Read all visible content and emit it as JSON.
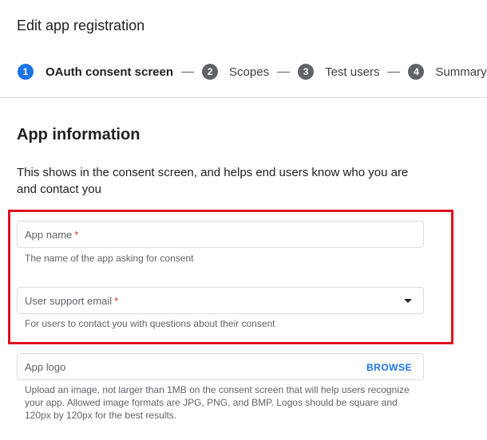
{
  "page": {
    "title": "Edit app registration"
  },
  "stepper": {
    "steps": [
      {
        "number": "1",
        "label": "OAuth consent screen"
      },
      {
        "number": "2",
        "label": "Scopes"
      },
      {
        "number": "3",
        "label": "Test users"
      },
      {
        "number": "4",
        "label": "Summary"
      }
    ]
  },
  "section": {
    "title": "App information",
    "description": "This shows in the consent screen, and helps end users know who you are and contact you"
  },
  "fields": {
    "app_name": {
      "label": "App name",
      "required_mark": "*",
      "helper": "The name of the app asking for consent"
    },
    "support_email": {
      "label": "User support email",
      "required_mark": "*",
      "helper": "For users to contact you with questions about their consent"
    },
    "app_logo": {
      "label": "App logo",
      "action": "BROWSE",
      "helper": "Upload an image, not larger than 1MB on the consent screen that will help users recognize your app. Allowed image formats are JPG, PNG, and BMP. Logos should be square and 120px by 120px for the best results."
    }
  },
  "colors": {
    "accent": "#1a73e8",
    "highlight_border": "#e0111f",
    "required": "#d93025"
  }
}
